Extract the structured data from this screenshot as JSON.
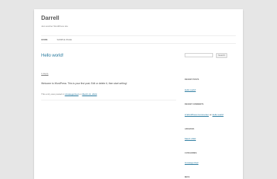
{
  "site": {
    "title": "Darrell",
    "description": "Just another WordPress site"
  },
  "nav": {
    "items": [
      {
        "label": "Home"
      },
      {
        "label": "Sample Page"
      }
    ]
  },
  "post": {
    "title": "Hello world!",
    "reply_label": "1 Reply",
    "body": "Welcome to WordPress. This is your first post. Edit or delete it, then start writing!",
    "meta_prefix": "This entry was posted in",
    "category": "Uncategorized",
    "meta_on": "on",
    "date": "March 21, 2022",
    "meta_suffix": "."
  },
  "sidebar": {
    "search_placeholder": "",
    "search_button": "Search",
    "recent_posts": {
      "title": "Recent Posts",
      "items": [
        "Hello world!"
      ]
    },
    "recent_comments": {
      "title": "Recent Comments",
      "author": "A WordPress Commenter",
      "on": "on",
      "post": "Hello world!"
    },
    "archives": {
      "title": "Archives",
      "items": [
        "March 2022"
      ]
    },
    "categories": {
      "title": "Categories",
      "items": [
        "Uncategorized"
      ]
    },
    "meta": {
      "title": "Meta"
    }
  },
  "colors": {
    "link": "#21759b",
    "background": "#e6e6e6",
    "page": "#ffffff"
  }
}
